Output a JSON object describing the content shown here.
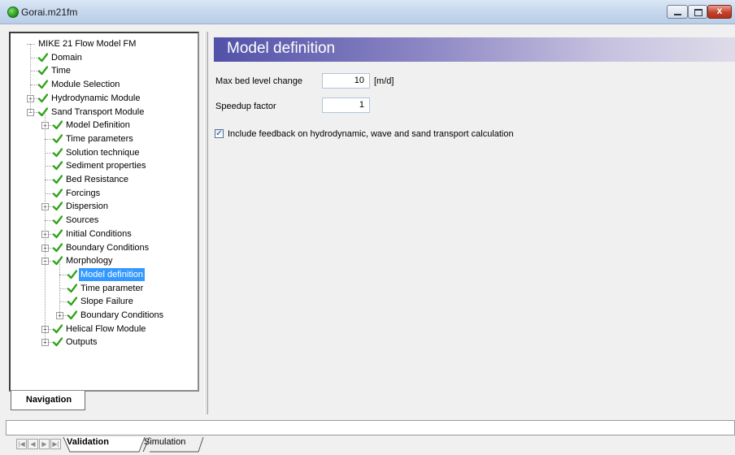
{
  "window": {
    "title": "Gorai.m21fm"
  },
  "window_buttons": {
    "minimize": "",
    "maximize": "",
    "close": "x"
  },
  "navigation": {
    "tab_label": "Navigation",
    "tree": [
      {
        "label": "MIKE 21 Flow Model FM",
        "level": 0,
        "expander": "none",
        "check": false
      },
      {
        "label": "Domain",
        "level": 1,
        "expander": "none",
        "check": true
      },
      {
        "label": "Time",
        "level": 1,
        "expander": "none",
        "check": true
      },
      {
        "label": "Module Selection",
        "level": 1,
        "expander": "none",
        "check": true
      },
      {
        "label": "Hydrodynamic Module",
        "level": 1,
        "expander": "plus",
        "check": true
      },
      {
        "label": "Sand Transport Module",
        "level": 1,
        "expander": "minus",
        "check": true
      },
      {
        "label": "Model Definition",
        "level": 2,
        "expander": "plus",
        "check": true
      },
      {
        "label": "Time parameters",
        "level": 2,
        "expander": "none",
        "check": true
      },
      {
        "label": "Solution technique",
        "level": 2,
        "expander": "none",
        "check": true
      },
      {
        "label": "Sediment properties",
        "level": 2,
        "expander": "none",
        "check": true
      },
      {
        "label": "Bed Resistance",
        "level": 2,
        "expander": "none",
        "check": true
      },
      {
        "label": "Forcings",
        "level": 2,
        "expander": "none",
        "check": true
      },
      {
        "label": "Dispersion",
        "level": 2,
        "expander": "plus",
        "check": true
      },
      {
        "label": "Sources",
        "level": 2,
        "expander": "none",
        "check": true
      },
      {
        "label": "Initial Conditions",
        "level": 2,
        "expander": "plus",
        "check": true
      },
      {
        "label": "Boundary Conditions",
        "level": 2,
        "expander": "plus",
        "check": true
      },
      {
        "label": "Morphology",
        "level": 2,
        "expander": "minus",
        "check": true
      },
      {
        "label": "Model definition",
        "level": 3,
        "expander": "none",
        "check": true,
        "selected": true
      },
      {
        "label": "Time parameter",
        "level": 3,
        "expander": "none",
        "check": true
      },
      {
        "label": "Slope Failure",
        "level": 3,
        "expander": "none",
        "check": true
      },
      {
        "label": "Boundary Conditions",
        "level": 3,
        "expander": "plus",
        "check": true
      },
      {
        "label": "Helical Flow Module",
        "level": 2,
        "expander": "plus",
        "check": true
      },
      {
        "label": "Outputs",
        "level": 2,
        "expander": "plus",
        "check": true
      }
    ]
  },
  "main": {
    "title": "Model definition",
    "max_bed_level_change": {
      "label": "Max bed level change",
      "value": "10",
      "unit": "[m/d]"
    },
    "speedup_factor": {
      "label": "Speedup factor",
      "value": "1"
    },
    "feedback": {
      "label": "Include feedback on hydrodynamic, wave and sand transport calculation",
      "checked": true,
      "mark": "✓"
    }
  },
  "bottom": {
    "tabs": [
      {
        "label": "Validation",
        "active": true
      },
      {
        "label": "Simulation",
        "active": false
      }
    ],
    "nav_arrows": [
      "|◀",
      "◀",
      "▶",
      "▶|"
    ]
  },
  "colors": {
    "header_gradient_start": "#5151a8",
    "selection": "#3399ff",
    "check_green": "#2fa31a"
  }
}
